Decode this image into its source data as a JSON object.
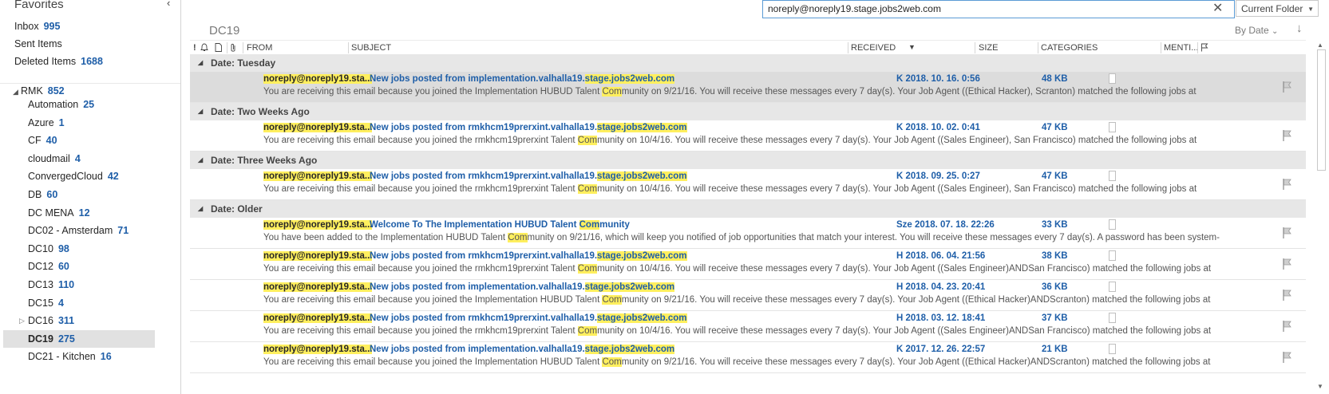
{
  "favorites": {
    "header": "Favorites",
    "items": [
      {
        "label": "Inbox",
        "count": "995"
      },
      {
        "label": "Sent Items",
        "count": ""
      },
      {
        "label": "Deleted Items",
        "count": "1688"
      }
    ]
  },
  "account": {
    "label": "RMK",
    "count": "852"
  },
  "folders": [
    {
      "label": "Automation",
      "count": "25"
    },
    {
      "label": "Azure",
      "count": "1"
    },
    {
      "label": "CF",
      "count": "40"
    },
    {
      "label": "cloudmail",
      "count": "4"
    },
    {
      "label": "ConvergedCloud",
      "count": "42"
    },
    {
      "label": "DB",
      "count": "60"
    },
    {
      "label": "DC MENA",
      "count": "12"
    },
    {
      "label": "DC02 - Amsterdam",
      "count": "71"
    },
    {
      "label": "DC10",
      "count": "98"
    },
    {
      "label": "DC12",
      "count": "60"
    },
    {
      "label": "DC13",
      "count": "110"
    },
    {
      "label": "DC15",
      "count": "4"
    },
    {
      "label": "DC16",
      "count": "311"
    },
    {
      "label": "DC19",
      "count": "275"
    },
    {
      "label": "DC21 - Kitchen",
      "count": "16"
    }
  ],
  "search": {
    "value": "noreply@noreply19.stage.jobs2web.com",
    "scope": "Current Folder"
  },
  "list": {
    "title": "DC19",
    "sort_label": "By Date",
    "sort_dir": "↓"
  },
  "columns": {
    "importance": "!",
    "from": "FROM",
    "subject": "SUBJECT",
    "received": "RECEIVED",
    "size": "SIZE",
    "categories": "CATEGORIES",
    "mentions": "MENTI..."
  },
  "groups": [
    {
      "label": "Date: Tuesday",
      "messages": [
        {
          "from": "noreply@noreply19.sta...",
          "subject": [
            "New jobs posted from implementation.valhalla19.",
            "stage.jobs2web.com"
          ],
          "received": "K 2018. 10. 16.  0:56",
          "size": "48 KB",
          "preview": [
            "You are receiving this email because you joined the Implementation HUBUD Talent ",
            "Com",
            "munity on 9/21/16. You will receive these messages every 7 day(s).  Your Job Agent ((Ethical Hacker), Scranton) matched the following jobs at"
          ]
        }
      ]
    },
    {
      "label": "Date: Two Weeks Ago",
      "messages": [
        {
          "from": "noreply@noreply19.sta...",
          "subject": [
            "New jobs posted from rmkhcm19prerxint.valhalla19.",
            "stage.jobs2web.com"
          ],
          "received": "K 2018. 10. 02.  0:41",
          "size": "47 KB",
          "preview": [
            "You are receiving this email because you joined the rmkhcm19prerxint Talent ",
            "Com",
            "munity on 10/4/16. You will receive these messages every 7 day(s).  Your Job Agent ((Sales Engineer), San Francisco) matched the following jobs at"
          ]
        }
      ]
    },
    {
      "label": "Date: Three Weeks Ago",
      "messages": [
        {
          "from": "noreply@noreply19.sta...",
          "subject": [
            "New jobs posted from rmkhcm19prerxint.valhalla19.",
            "stage.jobs2web.com"
          ],
          "received": "K 2018. 09. 25.  0:27",
          "size": "47 KB",
          "preview": [
            "You are receiving this email because you joined the rmkhcm19prerxint Talent ",
            "Com",
            "munity on 10/4/16. You will receive these messages every 7 day(s).  Your Job Agent ((Sales Engineer), San Francisco) matched the following jobs at"
          ]
        }
      ]
    },
    {
      "label": "Date: Older",
      "messages": [
        {
          "from": "noreply@noreply19.sta...",
          "subject": [
            "Welcome To The Implementation HUBUD Talent ",
            "Com",
            "munity"
          ],
          "received": "Sze 2018. 07. 18.  22:26",
          "size": "33 KB",
          "preview": [
            "You have been added to the Implementation HUBUD Talent ",
            "Com",
            "munity on 9/21/16, which will keep you notified of job opportunities that match your interest.  You will receive these messages every 7 day(s).  A password has been system-"
          ]
        },
        {
          "from": "noreply@noreply19.sta...",
          "subject": [
            "New jobs posted from rmkhcm19prerxint.valhalla19.",
            "stage.jobs2web.com"
          ],
          "received": "H 2018. 06. 04.  21:56",
          "size": "38 KB",
          "preview": [
            "You are receiving this email because you joined the rmkhcm19prerxint Talent ",
            "Com",
            "munity on 10/4/16. You will receive these messages every 7 day(s).  Your Job Agent ((Sales Engineer)ANDSan Francisco) matched the following jobs at"
          ]
        },
        {
          "from": "noreply@noreply19.sta...",
          "subject": [
            "New jobs posted from implementation.valhalla19.",
            "stage.jobs2web.com"
          ],
          "received": "H 2018. 04. 23.  20:41",
          "size": "36 KB",
          "preview": [
            "You are receiving this email because you joined the Implementation HUBUD Talent ",
            "Com",
            "munity on 9/21/16. You will receive these messages every 7 day(s).  Your Job Agent ((Ethical Hacker)ANDScranton) matched the following jobs at"
          ]
        },
        {
          "from": "noreply@noreply19.sta...",
          "subject": [
            "New jobs posted from rmkhcm19prerxint.valhalla19.",
            "stage.jobs2web.com"
          ],
          "received": "H 2018. 03. 12.  18:41",
          "size": "37 KB",
          "preview": [
            "You are receiving this email because you joined the rmkhcm19prerxint Talent ",
            "Com",
            "munity on 10/4/16. You will receive these messages every 7 day(s).  Your Job Agent ((Sales Engineer)ANDSan Francisco) matched the following jobs at"
          ]
        },
        {
          "from": "noreply@noreply19.sta...",
          "subject": [
            "New jobs posted from implementation.valhalla19.",
            "stage.jobs2web.com"
          ],
          "received": "K 2017. 12. 26.  22:57",
          "size": "21 KB",
          "preview": [
            "You are receiving this email because you joined the Implementation HUBUD Talent ",
            "Com",
            "munity on 9/21/16. You will receive these messages every 7 day(s).  Your Job Agent ((Ethical Hacker)ANDScranton) matched the following jobs at"
          ]
        }
      ]
    }
  ]
}
